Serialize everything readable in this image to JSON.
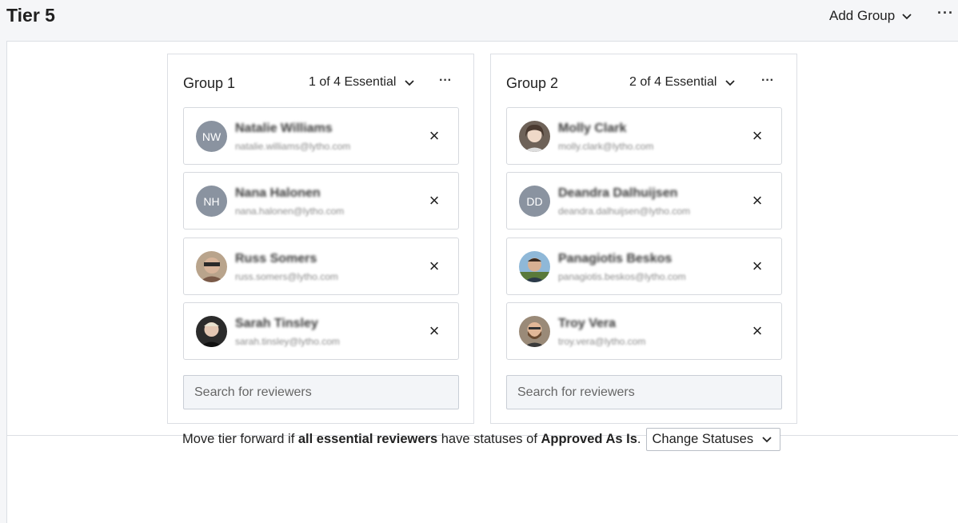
{
  "header": {
    "title": "Tier 5",
    "add_group_label": "Add Group",
    "more_label": "···"
  },
  "groups": [
    {
      "title": "Group 1",
      "essential": "1 of 4 Essential",
      "more_label": "···",
      "search_placeholder": "Search for reviewers",
      "reviewers": [
        {
          "name": "Natalie Williams",
          "email": "natalie.williams@lytho.com",
          "initials": "NW",
          "avatar": "initials"
        },
        {
          "name": "Nana Halonen",
          "email": "nana.halonen@lytho.com",
          "initials": "NH",
          "avatar": "initials"
        },
        {
          "name": "Russ Somers",
          "email": "russ.somers@lytho.com",
          "initials": "",
          "avatar": "photo"
        },
        {
          "name": "Sarah Tinsley",
          "email": "sarah.tinsley@lytho.com",
          "initials": "",
          "avatar": "photo"
        }
      ]
    },
    {
      "title": "Group 2",
      "essential": "2 of 4 Essential",
      "more_label": "···",
      "search_placeholder": "Search for reviewers",
      "reviewers": [
        {
          "name": "Molly Clark",
          "email": "molly.clark@lytho.com",
          "initials": "",
          "avatar": "photo"
        },
        {
          "name": "Deandra Dalhuijsen",
          "email": "deandra.dalhuijsen@lytho.com",
          "initials": "DD",
          "avatar": "initials"
        },
        {
          "name": "Panagiotis Beskos",
          "email": "panagiotis.beskos@lytho.com",
          "initials": "",
          "avatar": "photo"
        },
        {
          "name": "Troy Vera",
          "email": "troy.vera@lytho.com",
          "initials": "",
          "avatar": "photo"
        }
      ]
    }
  ],
  "footer": {
    "text_1": "Move tier forward if ",
    "bold_1": "all essential reviewers",
    "text_2": " have statuses of ",
    "bold_2": "Approved As Is",
    "text_3": ".",
    "select_label": "Change Statuses"
  },
  "colors": {
    "initials_avatar": "#8a93a0",
    "border": "#dcdfe4",
    "page_bg": "#f5f6f8"
  }
}
